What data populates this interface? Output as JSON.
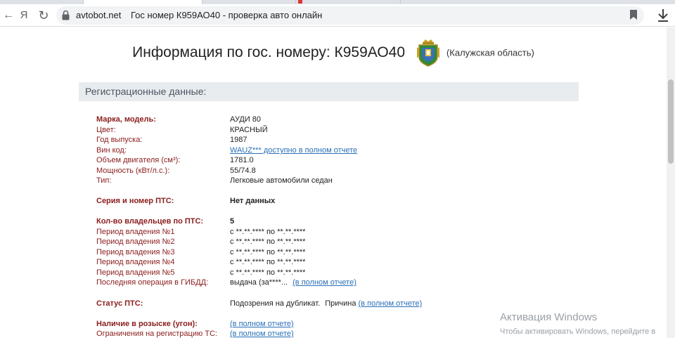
{
  "browser": {
    "url_host": "avtobot.net",
    "page_title": "Гос номер К959АО40 - проверка авто онлайн",
    "back_glyph": "←",
    "yandex_glyph": "Я",
    "reload_glyph": "↻"
  },
  "header": {
    "title": "Информация по гос. номеру: К959АО40",
    "region": "(Калужская область)"
  },
  "section": {
    "title": "Регистрационные данные:"
  },
  "vehicle": {
    "make_label": "Марка, модель:",
    "make_value": "АУДИ 80",
    "color_label": "Цвет:",
    "color_value": "КРАСНЫЙ",
    "year_label": "Год выпуска:",
    "year_value": "1987",
    "vin_label": "Вин код:",
    "vin_value": "WAUZ*** доступно в полном отчете",
    "engine_label": "Объем двигателя (см³):",
    "engine_value": "1781.0",
    "power_label": "Мощность (кВт/л.с.):",
    "power_value": "55/74.8",
    "type_label": "Тип:",
    "type_value": "Легковые автомобили седан"
  },
  "pts": {
    "series_label": "Серия и номер ПТС:",
    "series_value": "Нет данных"
  },
  "owners": {
    "count_label": "Кол-во владельцев по ПТС:",
    "count_value": "5",
    "periods": [
      {
        "label": "Период владения №1",
        "value": "с **.**.**** по **.**.****"
      },
      {
        "label": "Период владения №2",
        "value": "с **.**.**** по **.**.****"
      },
      {
        "label": "Период владения №3",
        "value": "с **.**.**** по **.**.****"
      },
      {
        "label": "Период владения №4",
        "value": "с **.**.**** по **.**.****"
      },
      {
        "label": "Период владения №5",
        "value": "с **.**.**** по **.**.****"
      }
    ],
    "last_op_label": "Последняя операция в ГИБДД:",
    "last_op_value": "выдача (за****...",
    "last_op_link": "(в полном отчете)"
  },
  "status": {
    "label": "Статус ПТС:",
    "value": "Подозрения на дубликат.",
    "reason": "Причина",
    "link": "(в полном отчете)"
  },
  "wanted": {
    "label": "Наличие в розыске (угон):",
    "link": "(в полном отчете)",
    "restrict_label": "Ограничения на регистрацию ТС:",
    "restrict_link": "(в полном отчете)"
  },
  "watermark": {
    "line1": "Активация Windows",
    "line2": "Чтобы активировать Windows, перейдите в"
  }
}
